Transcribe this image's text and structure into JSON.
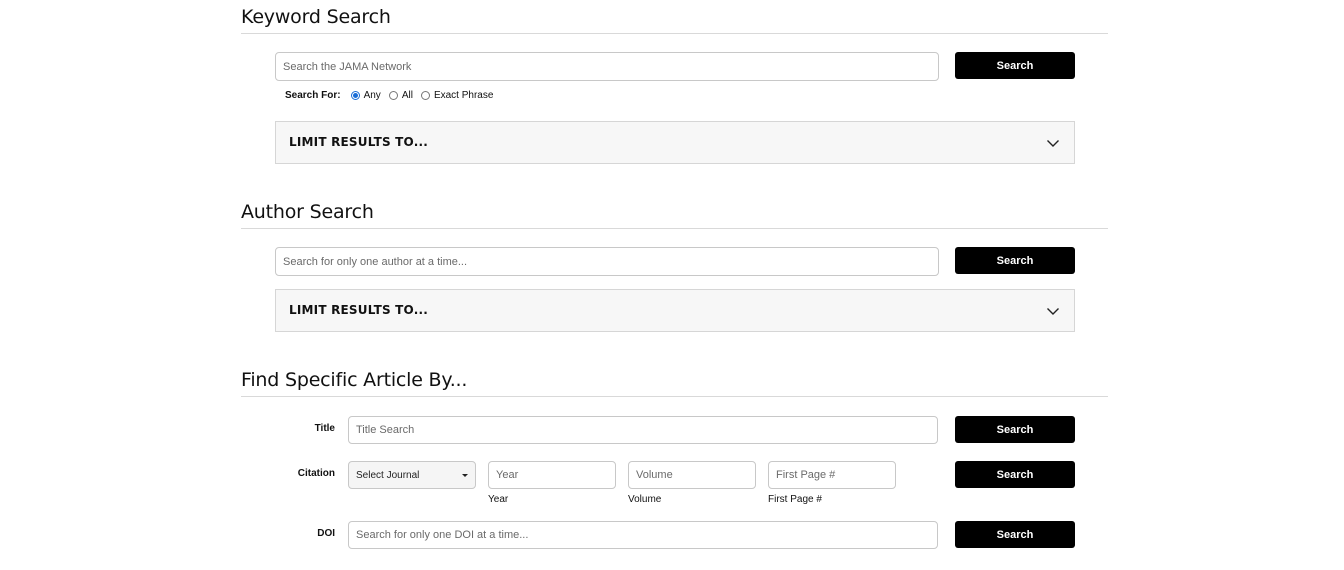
{
  "keyword_search": {
    "title": "Keyword Search",
    "placeholder": "Search the JAMA Network",
    "button": "Search",
    "search_for_label": "Search For:",
    "options": [
      "Any",
      "All",
      "Exact Phrase"
    ],
    "selected_option": "Any",
    "limit_label": "LIMIT RESULTS TO..."
  },
  "author_search": {
    "title": "Author Search",
    "placeholder": "Search for only one author at a time...",
    "button": "Search",
    "limit_label": "LIMIT RESULTS TO..."
  },
  "specific_article": {
    "title": "Find Specific Article By...",
    "title_row": {
      "label": "Title",
      "placeholder": "Title Search",
      "button": "Search"
    },
    "citation_row": {
      "label": "Citation",
      "journal_select": "Select Journal",
      "year_placeholder": "Year",
      "volume_placeholder": "Volume",
      "first_page_placeholder": "First Page #",
      "year_label": "Year",
      "volume_label": "Volume",
      "first_page_label": "First Page #",
      "button": "Search"
    },
    "doi_row": {
      "label": "DOI",
      "placeholder": "Search for only one DOI at a time...",
      "button": "Search"
    }
  },
  "icons": {
    "limit_toggle": "chevron-down-icon",
    "select_caret": "caret-down-icon"
  }
}
